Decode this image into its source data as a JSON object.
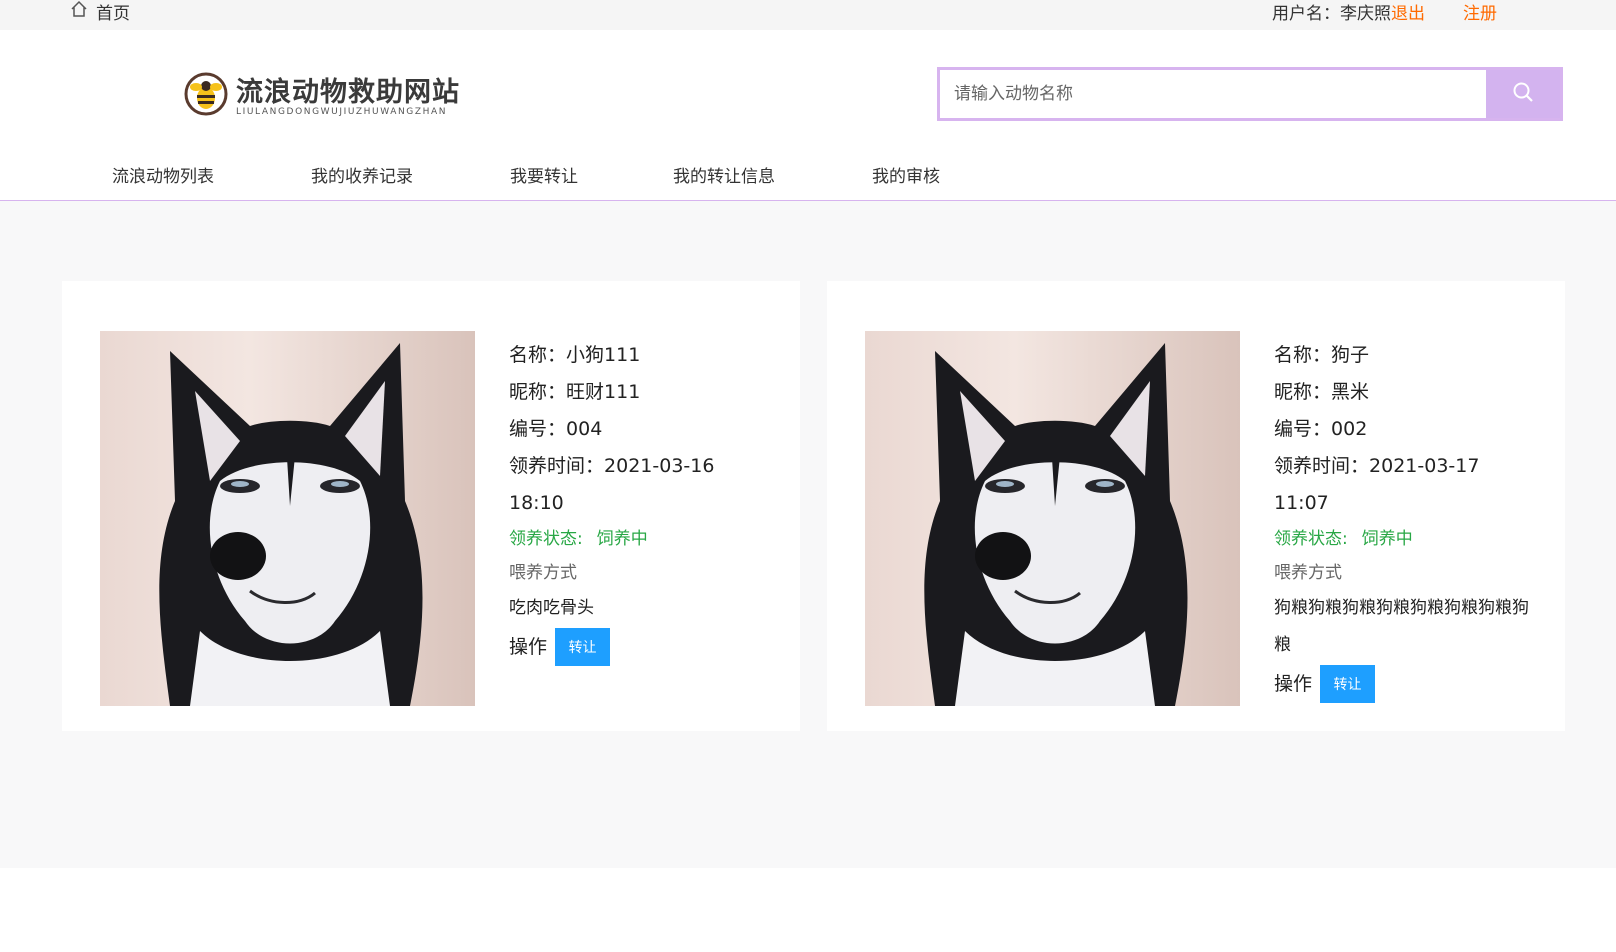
{
  "topbar": {
    "home_label": "首页",
    "user_prefix": "用户名：",
    "username": "李庆照",
    "logout_label": "退出",
    "register_label": "注册"
  },
  "logo": {
    "title": "流浪动物救助网站",
    "subtitle": "LIULANGDONGWUJIUZHUWANGZHAN"
  },
  "search": {
    "placeholder": "请输入动物名称",
    "value": ""
  },
  "nav": {
    "items": [
      "流浪动物列表",
      "我的收养记录",
      "我要转让",
      "我的转让信息",
      "我的审核"
    ]
  },
  "labels": {
    "name": "名称：",
    "nickname": "昵称：",
    "number": "编号：",
    "adopt_time": "领养时间：",
    "adopt_status": "领养状态:",
    "feed_method": "喂养方式",
    "operation": "操作",
    "transfer_button": "转让"
  },
  "cards": [
    {
      "name": "小狗111",
      "nickname": "旺财111",
      "number": "004",
      "adopt_time": "2021-03-16 18:10",
      "status": "饲养中",
      "feed": "吃肉吃骨头"
    },
    {
      "name": "狗子",
      "nickname": "黑米",
      "number": "002",
      "adopt_time": "2021-03-17 11:07",
      "status": "饲养中",
      "feed": "狗粮狗粮狗粮狗粮狗粮狗粮狗粮狗粮"
    }
  ],
  "colors": {
    "accent": "#d3b3ef",
    "link": "#ff6a00",
    "status_green": "#28a745",
    "button_blue": "#1e9fff"
  }
}
